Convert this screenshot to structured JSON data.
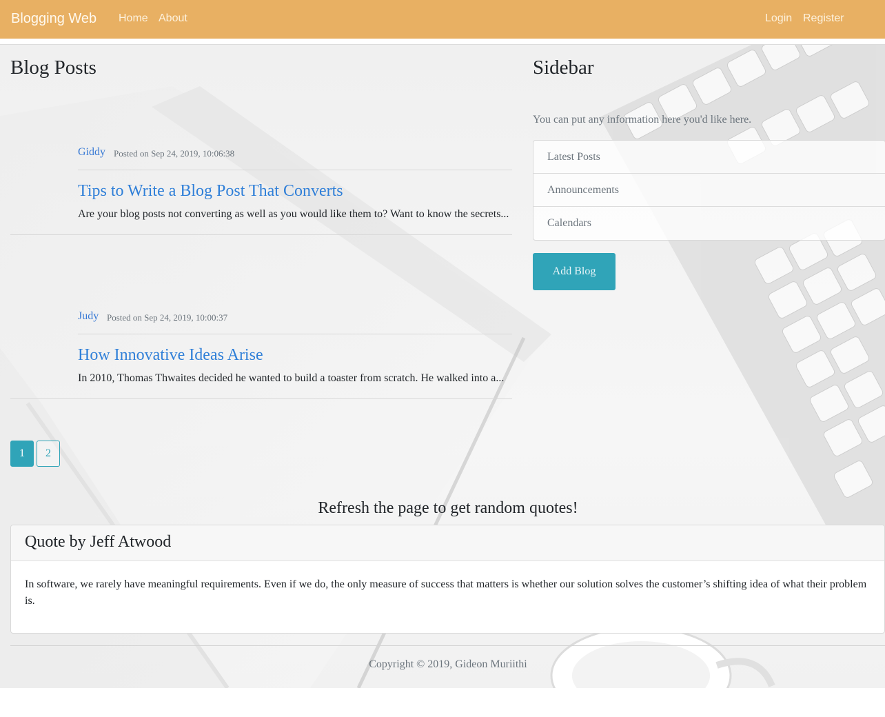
{
  "navbar": {
    "brand": "Blogging Web",
    "links": [
      "Home",
      "About"
    ],
    "auth": [
      "Login",
      "Register"
    ]
  },
  "main": {
    "title": "Blog Posts",
    "posts": [
      {
        "author": "Giddy",
        "date": "Posted on Sep 24, 2019, 10:06:38",
        "title": "Tips to Write a Blog Post That Converts",
        "excerpt": "Are your blog posts not converting as well as you would like them to? Want to know the secrets..."
      },
      {
        "author": "Judy",
        "date": "Posted on Sep 24, 2019, 10:00:37",
        "title": "How Innovative Ideas Arise",
        "excerpt": "In 2010, Thomas Thwaites decided he wanted to build a toaster from scratch. He walked into a..."
      }
    ],
    "pagination": [
      "1",
      "2"
    ]
  },
  "sidebar": {
    "title": "Sidebar",
    "text": "You can put any information here you'd like here.",
    "items": [
      "Latest Posts",
      "Announcements",
      "Calendars"
    ],
    "add_button": "Add Blog"
  },
  "quote": {
    "heading": "Refresh the page to get random quotes!",
    "author_line": "Quote by Jeff Atwood",
    "text": "In software, we rarely have meaningful requirements. Even if we do, the only measure of success that matters is whether our solution solves the customer’s shifting idea of what their problem is."
  },
  "footer": {
    "copyright": "Copyright © 2019, Gideon Muriithi"
  }
}
